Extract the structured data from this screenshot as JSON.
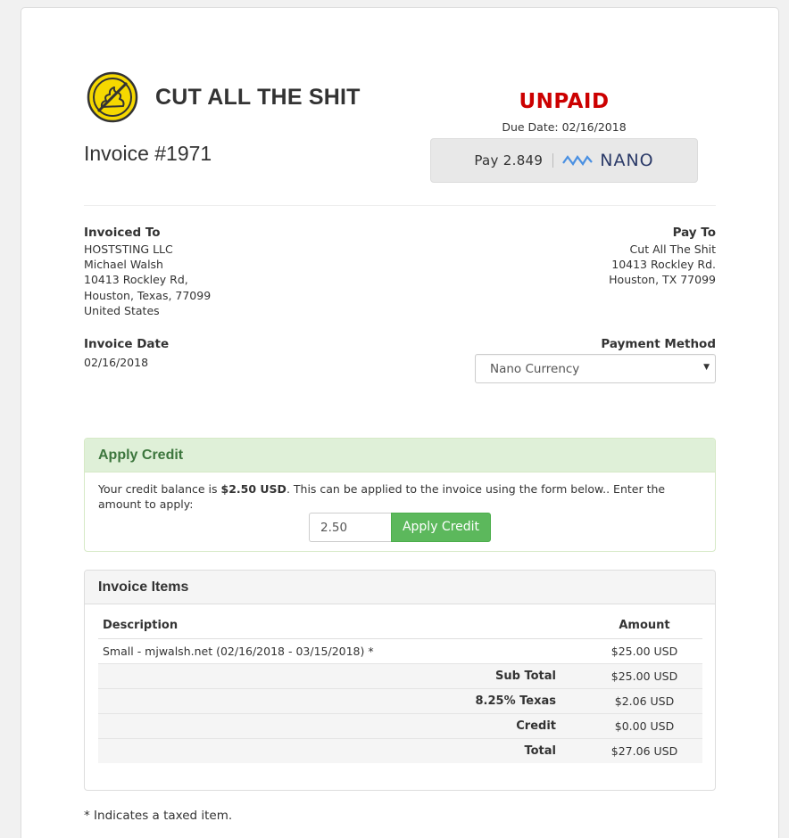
{
  "brand": {
    "name": "CUT ALL THE SHIT",
    "logo_icon": "no-poop-icon",
    "logo_color": "#f5d800"
  },
  "invoice": {
    "title": "Invoice #1971",
    "status": "UNPAID",
    "due_date": "Due Date: 02/16/2018",
    "status_color": "#cc0000"
  },
  "pay_button": {
    "label": "Pay 2.849",
    "currency_icon": "nano-icon",
    "currency": "NANO"
  },
  "invoiced_to": {
    "label": "Invoiced To",
    "lines": [
      "HOSTSTING LLC",
      "Michael Walsh",
      "10413 Rockley Rd,",
      "Houston, Texas, 77099",
      "United States"
    ]
  },
  "pay_to": {
    "label": "Pay To",
    "lines": [
      "Cut All The Shit",
      "10413 Rockley Rd.",
      "Houston, TX 77099"
    ]
  },
  "invoice_date": {
    "label": "Invoice Date",
    "value": "02/16/2018"
  },
  "payment_method": {
    "label": "Payment Method",
    "selected": "Nano Currency"
  },
  "credit": {
    "title": "Apply Credit",
    "text_before": "Your credit balance is ",
    "balance": "$2.50 USD",
    "text_after": ". This can be applied to the invoice using the form below.. Enter the amount to apply:",
    "input_value": "2.50",
    "button_label": "Apply Credit",
    "accent": "#5cb85c"
  },
  "items": {
    "title": "Invoice Items",
    "headers": {
      "description": "Description",
      "amount": "Amount"
    },
    "rows": [
      {
        "description": "Small - mjwalsh.net (02/16/2018 - 03/15/2018) *",
        "amount": "$25.00 USD"
      }
    ],
    "totals": [
      {
        "label": "Sub Total",
        "amount": "$25.00 USD"
      },
      {
        "label": "8.25% Texas",
        "amount": "$2.06 USD"
      },
      {
        "label": "Credit",
        "amount": "$0.00 USD"
      },
      {
        "label": "Total",
        "amount": "$27.06 USD"
      }
    ]
  },
  "footnote": "* Indicates a taxed item."
}
